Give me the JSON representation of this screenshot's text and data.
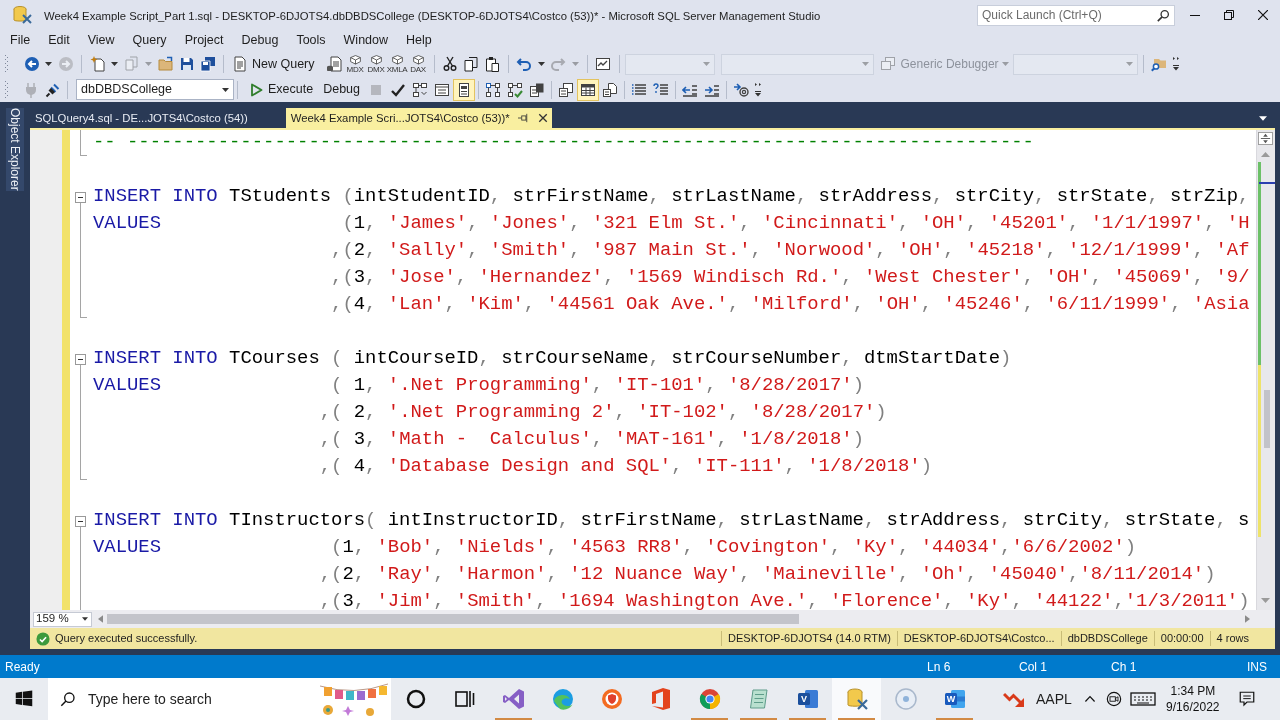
{
  "window": {
    "title": "Week4 Example Script_Part 1.sql - DESKTOP-6DJOTS4.dbDBDSCollege (DESKTOP-6DJOTS4\\Costco (53))* - Microsoft SQL Server Management Studio",
    "quick_launch": {
      "placeholder": "Quick Launch (Ctrl+Q)"
    }
  },
  "menu": [
    "File",
    "Edit",
    "View",
    "Query",
    "Project",
    "Debug",
    "Tools",
    "Window",
    "Help"
  ],
  "toolbars": [
    {
      "items": [
        {
          "kind": "split",
          "disabled": false
        },
        {
          "kind": "icon",
          "disabled": true
        },
        {
          "kind": "separator"
        },
        {
          "kind": "split",
          "disabled": false
        },
        {
          "kind": "split",
          "disabled": true
        },
        {
          "kind": "icon",
          "disabled": false
        },
        {
          "kind": "icon",
          "disabled": false
        },
        {
          "kind": "icon",
          "disabled": false
        },
        {
          "kind": "separator"
        },
        {
          "kind": "button",
          "label": "New Query",
          "disabled": false
        },
        {
          "kind": "icon",
          "disabled": false
        },
        {
          "kind": "cube",
          "label": "MDX",
          "disabled": false
        },
        {
          "kind": "cube",
          "label": "DMX",
          "disabled": false
        },
        {
          "kind": "cube",
          "label": "XMLA",
          "disabled": false
        },
        {
          "kind": "cube",
          "label": "DAX",
          "disabled": false
        },
        {
          "kind": "separator"
        },
        {
          "kind": "icon",
          "disabled": false
        },
        {
          "kind": "icon",
          "disabled": false
        },
        {
          "kind": "icon",
          "disabled": false
        },
        {
          "kind": "separator"
        },
        {
          "kind": "split",
          "disabled": false
        },
        {
          "kind": "split",
          "disabled": true
        },
        {
          "kind": "separator"
        },
        {
          "kind": "icon",
          "disabled": false
        },
        {
          "kind": "separator"
        },
        {
          "kind": "combo",
          "disabled": true
        },
        {
          "kind": "combo",
          "disabled": true
        },
        {
          "kind": "dropdown_button",
          "label": "Generic Debugger",
          "disabled": true
        },
        {
          "kind": "combo",
          "disabled": true
        },
        {
          "kind": "separator"
        },
        {
          "kind": "icon",
          "disabled": false
        },
        {
          "kind": "overflow"
        }
      ]
    },
    {
      "items": [
        {
          "kind": "icon",
          "disabled": true
        },
        {
          "kind": "icon",
          "disabled": false
        },
        {
          "kind": "separator"
        },
        {
          "kind": "combo",
          "value": "dbDBDSCollege",
          "disabled": false
        },
        {
          "kind": "separator"
        },
        {
          "kind": "button",
          "label": "Execute",
          "disabled": false
        },
        {
          "kind": "text_button",
          "label": "Debug",
          "disabled": false
        },
        {
          "kind": "icon",
          "disabled": true
        },
        {
          "kind": "icon",
          "disabled": false
        },
        {
          "kind": "icon",
          "disabled": false
        },
        {
          "kind": "icon",
          "disabled": false
        },
        {
          "kind": "toggle",
          "on": true,
          "disabled": false
        },
        {
          "kind": "separator"
        },
        {
          "kind": "toggle",
          "on": false,
          "disabled": false
        },
        {
          "kind": "toggle",
          "on": false,
          "disabled": false
        },
        {
          "kind": "toggle",
          "on": false,
          "disabled": false
        },
        {
          "kind": "separator"
        },
        {
          "kind": "toggle",
          "on": false,
          "disabled": false
        },
        {
          "kind": "toggle",
          "on": true,
          "disabled": false
        },
        {
          "kind": "toggle",
          "on": false,
          "disabled": false
        },
        {
          "kind": "separator"
        },
        {
          "kind": "icon",
          "disabled": false
        },
        {
          "kind": "icon",
          "disabled": false
        },
        {
          "kind": "separator"
        },
        {
          "kind": "icon",
          "disabled": false
        },
        {
          "kind": "icon",
          "disabled": false
        },
        {
          "kind": "separator"
        },
        {
          "kind": "icon",
          "disabled": false
        },
        {
          "kind": "overflow"
        }
      ]
    }
  ],
  "side_panel": {
    "label": "Object Explorer"
  },
  "tabs": [
    {
      "label": "SQLQuery4.sql - DE...JOTS4\\Costco (54))",
      "selected": false
    },
    {
      "label": "Week4 Example Scri...JOTS4\\Costco (53))*",
      "selected": true
    }
  ],
  "editor": {
    "lines": [
      {
        "kind": "end",
        "comment": "-- --------------------------------------------------------------------------------",
        "modified": true
      },
      {
        "kind": "plain",
        "modified": true
      },
      {
        "kind": "start",
        "keyword": "INSERT INTO",
        "text": " TStudents (intStudentID, strFirstName, strLastName, strAddress, strCity, strState, strZip,",
        "modified": true
      },
      {
        "kind": "inside",
        "keyword": "VALUES",
        "text": "                (1, 'James', 'Jones', '321 Elm St.', 'Cincinnati', 'OH', '45201', '1/1/1997', 'H",
        "modified": true
      },
      {
        "kind": "inside",
        "text": "                     ,(2, 'Sally', 'Smith', '987 Main St.', 'Norwood', 'OH', '45218', '12/1/1999', 'Af",
        "modified": true
      },
      {
        "kind": "inside",
        "text": "                     ,(3, 'Jose', 'Hernandez', '1569 Windisch Rd.', 'West Chester', 'OH', '45069', '9/",
        "modified": true
      },
      {
        "kind": "end",
        "text": "                     ,(4, 'Lan', 'Kim', '44561 Oak Ave.', 'Milford', 'OH', '45246', '6/11/1999', 'Asia",
        "modified": true
      },
      {
        "kind": "plain",
        "modified": true
      },
      {
        "kind": "start",
        "keyword": "INSERT INTO",
        "text": " TCourses ( intCourseID, strCourseName, strCourseNumber, dtmStartDate)",
        "modified": true
      },
      {
        "kind": "inside",
        "keyword": "VALUES",
        "text": "               ( 1, '.Net Programming', 'IT-101', '8/28/2017')",
        "modified": true
      },
      {
        "kind": "inside",
        "text": "                    ,( 2, '.Net Programming 2', 'IT-102', '8/28/2017')",
        "modified": true
      },
      {
        "kind": "inside",
        "text": "                    ,( 3, 'Math -  Calculus', 'MAT-161', '1/8/2018')",
        "modified": true
      },
      {
        "kind": "end",
        "text": "                    ,( 4, 'Database Design and SQL', 'IT-111', '1/8/2018')",
        "modified": true
      },
      {
        "kind": "plain",
        "modified": true
      },
      {
        "kind": "start",
        "keyword": "INSERT INTO",
        "text": " TInstructors( intInstructorID, strFirstName, strLastName, strAddress, strCity, strState, s",
        "modified": true
      },
      {
        "kind": "inside",
        "keyword": "VALUES",
        "text": "               (1, 'Bob', 'Nields', '4563 RR8', 'Covington', 'Ky', '44034','6/6/2002')",
        "modified": true
      },
      {
        "kind": "inside",
        "text": "                    ,(2, 'Ray', 'Harmon', '12 Nuance Way', 'Maineville', 'Oh', '45040','8/11/2014')",
        "modified": true
      },
      {
        "kind": "inside",
        "text": "                    ,(3, 'Jim', 'Smith', '1694 Washington Ave.', 'Florence', 'Ky', '44122','1/3/2011')",
        "modified": true
      }
    ],
    "zoom": "159 %"
  },
  "query_status": {
    "success": true,
    "message": "Query executed successfully.",
    "fields": [
      "DESKTOP-6DJOTS4 (14.0 RTM)",
      "DESKTOP-6DJOTS4\\Costco...",
      "dbDBDSCollege",
      "00:00:00",
      "4 rows"
    ]
  },
  "status_bar": {
    "state": "Ready",
    "fields": [
      "Ln 6",
      "Col 1",
      "Ch 1",
      "INS"
    ]
  },
  "taskbar": {
    "search": {
      "placeholder": "Type here to search"
    },
    "apps": [
      {
        "running": false,
        "active": false
      },
      {
        "running": false,
        "active": false
      },
      {
        "running": true,
        "active": false
      },
      {
        "running": false,
        "active": false
      },
      {
        "running": false,
        "active": false
      },
      {
        "running": false,
        "active": false
      },
      {
        "running": true,
        "active": false
      },
      {
        "running": true,
        "active": false
      },
      {
        "running": true,
        "active": false,
        "letter": "V"
      },
      {
        "running": true,
        "active": true
      },
      {
        "running": false,
        "active": false
      },
      {
        "running": true,
        "active": false,
        "letter": "W"
      }
    ],
    "stock": {
      "symbol": "AAPL"
    },
    "clock": {
      "time": "1:34 PM",
      "date": "9/16/2022"
    }
  }
}
